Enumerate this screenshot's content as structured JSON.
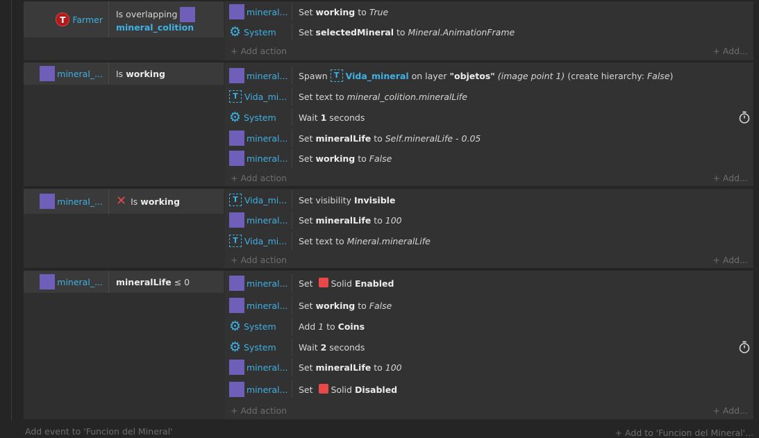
{
  "add_action_label": "Add action",
  "add_more_label": "Add...",
  "events": [
    {
      "condition": {
        "object": "Farmer",
        "text": "Is overlapping",
        "target": "mineral_colition"
      },
      "actions": [
        {
          "object": "mineral...",
          "pre": "Set ",
          "bold": "working",
          "mid": " to ",
          "italic": "True"
        },
        {
          "object": "System",
          "pre": "Set ",
          "bold": "selectedMineral",
          "mid": " to ",
          "italic": "Mineral.AnimationFrame"
        }
      ]
    },
    {
      "condition": {
        "object": "mineral_...",
        "text": "Is",
        "bold": "working"
      },
      "actions": [
        {
          "object": "mineral...",
          "spawn_pre": "Spawn ",
          "spawn_obj": "Vida_mineral",
          "spawn_mid": " on layer ",
          "spawn_layer": "\"objetos\"",
          "spawn_ip": "(image point 1)",
          "spawn_ch": " (create hierarchy: ",
          "spawn_chv": "False",
          "spawn_end": ")"
        },
        {
          "object": "Vida_mi...",
          "pre": "Set text to ",
          "italic": "mineral_colition.mineralLife"
        },
        {
          "object": "System",
          "pre": "Wait ",
          "bold": "1",
          "mid": " seconds"
        },
        {
          "object": "mineral...",
          "pre": "Set ",
          "bold": "mineralLife",
          "mid": " to ",
          "italic": "Self.mineralLife - 0.05"
        },
        {
          "object": "mineral...",
          "pre": "Set ",
          "bold": "working",
          "mid": " to ",
          "italic": "False"
        }
      ]
    },
    {
      "condition": {
        "object": "mineral_...",
        "text": "Is",
        "bold": "working"
      },
      "actions": [
        {
          "object": "Vida_mi...",
          "pre": "Set visibility ",
          "bold": "Invisible"
        },
        {
          "object": "mineral...",
          "pre": "Set ",
          "bold": "mineralLife",
          "mid": " to ",
          "italic": "100"
        },
        {
          "object": "Vida_mi...",
          "pre": "Set text to ",
          "italic": "Mineral.mineralLife"
        }
      ]
    },
    {
      "condition": {
        "object": "mineral_...",
        "bold": "mineralLife",
        "text": " ≤ 0"
      },
      "actions": [
        {
          "object": "mineral...",
          "pre": "Set ",
          "mid": "Solid ",
          "bold": "Enabled"
        },
        {
          "object": "mineral...",
          "pre": "Set ",
          "bold": "working",
          "mid": " to ",
          "italic": "False"
        },
        {
          "object": "System",
          "pre": "Add ",
          "italic": "1",
          "mid": " to ",
          "bold": "Coins"
        },
        {
          "object": "System",
          "pre": "Wait ",
          "bold": "2",
          "mid": " seconds"
        },
        {
          "object": "mineral...",
          "pre": "Set ",
          "bold": "mineralLife",
          "mid": " to ",
          "italic": "100"
        },
        {
          "object": "mineral...",
          "pre": "Set ",
          "mid": "Solid ",
          "bold": "Disabled"
        }
      ]
    }
  ],
  "footer": {
    "add_event": "Add event to 'Funcion del Mineral'",
    "add_to": "Add to 'Funcion del Mineral'..."
  }
}
